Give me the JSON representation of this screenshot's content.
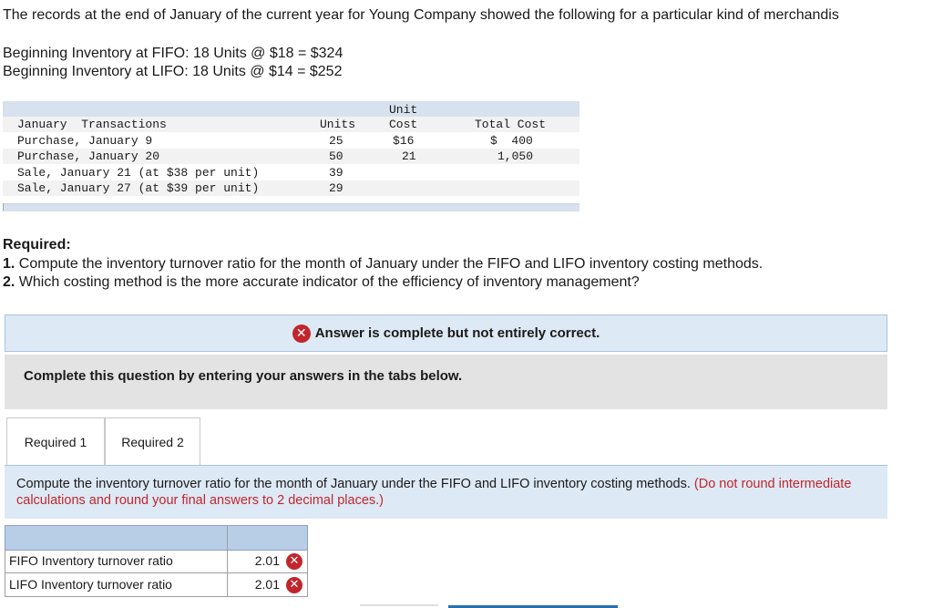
{
  "intro": "The records at the end of January of the current year for Young Company showed the following for a particular kind of merchandis",
  "beginning": [
    "Beginning Inventory at FIFO: 18 Units @ $18 = $324",
    "Beginning Inventory at LIFO: 18 Units @ $14 = $252"
  ],
  "transactions": {
    "header_unit": "Unit",
    "header": {
      "label": "January  Transactions",
      "units": "Units",
      "cost": "Cost",
      "total": "Total Cost"
    },
    "rows": [
      {
        "label": "Purchase, January 9",
        "units": "25",
        "cost": "$16",
        "total": "$  400"
      },
      {
        "label": "Purchase, January 20",
        "units": "50",
        "cost": "21",
        "total": "1,050"
      },
      {
        "label": "Sale, January 21 (at $38 per unit)",
        "units": "39",
        "cost": "",
        "total": ""
      },
      {
        "label": "Sale, January 27 (at $39 per unit)",
        "units": "29",
        "cost": "",
        "total": ""
      }
    ]
  },
  "required": {
    "title": "Required:",
    "items": [
      {
        "num": "1.",
        "text": " Compute the inventory turnover ratio for the month of January under the FIFO and LIFO inventory costing methods."
      },
      {
        "num": "2.",
        "text": " Which costing method is the more accurate indicator of the efficiency of inventory management?"
      }
    ]
  },
  "status_banner": "Answer is complete but not entirely correct.",
  "complete_banner": "Complete this question by entering your answers in the tabs below.",
  "tabs": [
    {
      "label": "Required 1",
      "active": true
    },
    {
      "label": "Required 2",
      "active": false
    }
  ],
  "instruction": {
    "text": "Compute the inventory turnover ratio for the month of January under the FIFO and LIFO inventory costing methods. ",
    "note": "(Do not round intermediate calculations and round your final answers to 2 decimal places.)"
  },
  "answers": [
    {
      "label": "FIFO Inventory turnover ratio",
      "value": "2.01",
      "status": "incorrect"
    },
    {
      "label": "LIFO Inventory turnover ratio",
      "value": "2.01",
      "status": "incorrect"
    }
  ],
  "icons": {
    "incorrect": "close-circle-icon"
  },
  "colors": {
    "accent_blue": "#2a6fb0",
    "error_red": "#c0262c",
    "panel_blue": "#dde9f5",
    "header_blue": "#b8cde6"
  }
}
